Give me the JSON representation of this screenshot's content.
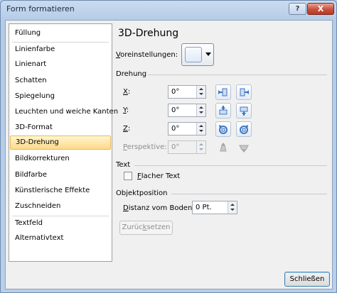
{
  "window": {
    "title": "Form formatieren",
    "help_label": "?",
    "close_label": "X"
  },
  "nav": {
    "items": [
      {
        "label": "Füllung"
      },
      {
        "label": "Linienfarbe"
      },
      {
        "label": "Linienart"
      },
      {
        "label": "Schatten"
      },
      {
        "label": "Spiegelung"
      },
      {
        "label": "Leuchten und weiche Kanten"
      },
      {
        "label": "3D-Format"
      },
      {
        "label": "3D-Drehung",
        "selected": true
      },
      {
        "label": "Bildkorrekturen"
      },
      {
        "label": "Bildfarbe"
      },
      {
        "label": "Künstlerische Effekte"
      },
      {
        "label": "Zuschneiden"
      },
      {
        "label": "Textfeld"
      },
      {
        "label": "Alternativtext"
      }
    ]
  },
  "panel": {
    "heading": "3D-Drehung",
    "presets": {
      "label_prefix": "V",
      "label_rest": "oreinstellungen:"
    },
    "rotation": {
      "section_title": "Drehung",
      "x": {
        "label_key": "X",
        "label_rest": ":",
        "value": "0°"
      },
      "y": {
        "label_key": "Y",
        "label_rest": ":",
        "value": "0°"
      },
      "z": {
        "label_key": "Z",
        "label_rest": ":",
        "value": "0°"
      },
      "perspective": {
        "label_key": "P",
        "label_rest": "erspektive:",
        "value": "0°"
      }
    },
    "text": {
      "section_title": "Text",
      "flat_text": {
        "label_key": "F",
        "label_rest": "lacher Text",
        "checked": false
      }
    },
    "position": {
      "section_title": "Objektposition",
      "distance": {
        "label_key": "D",
        "label_rest": "istanz vom Boden:",
        "value": "0 Pt."
      }
    },
    "reset": {
      "label_pre": "Zurüc",
      "label_key": "k",
      "label_post": "setzen"
    }
  },
  "footer": {
    "close_label": "Schließen"
  },
  "colors": {
    "selection_fill": "#ffd88a",
    "selection_border": "#e3b863",
    "rotate_icon_blue": "#3b78c6",
    "close_red": "#c8513b"
  }
}
